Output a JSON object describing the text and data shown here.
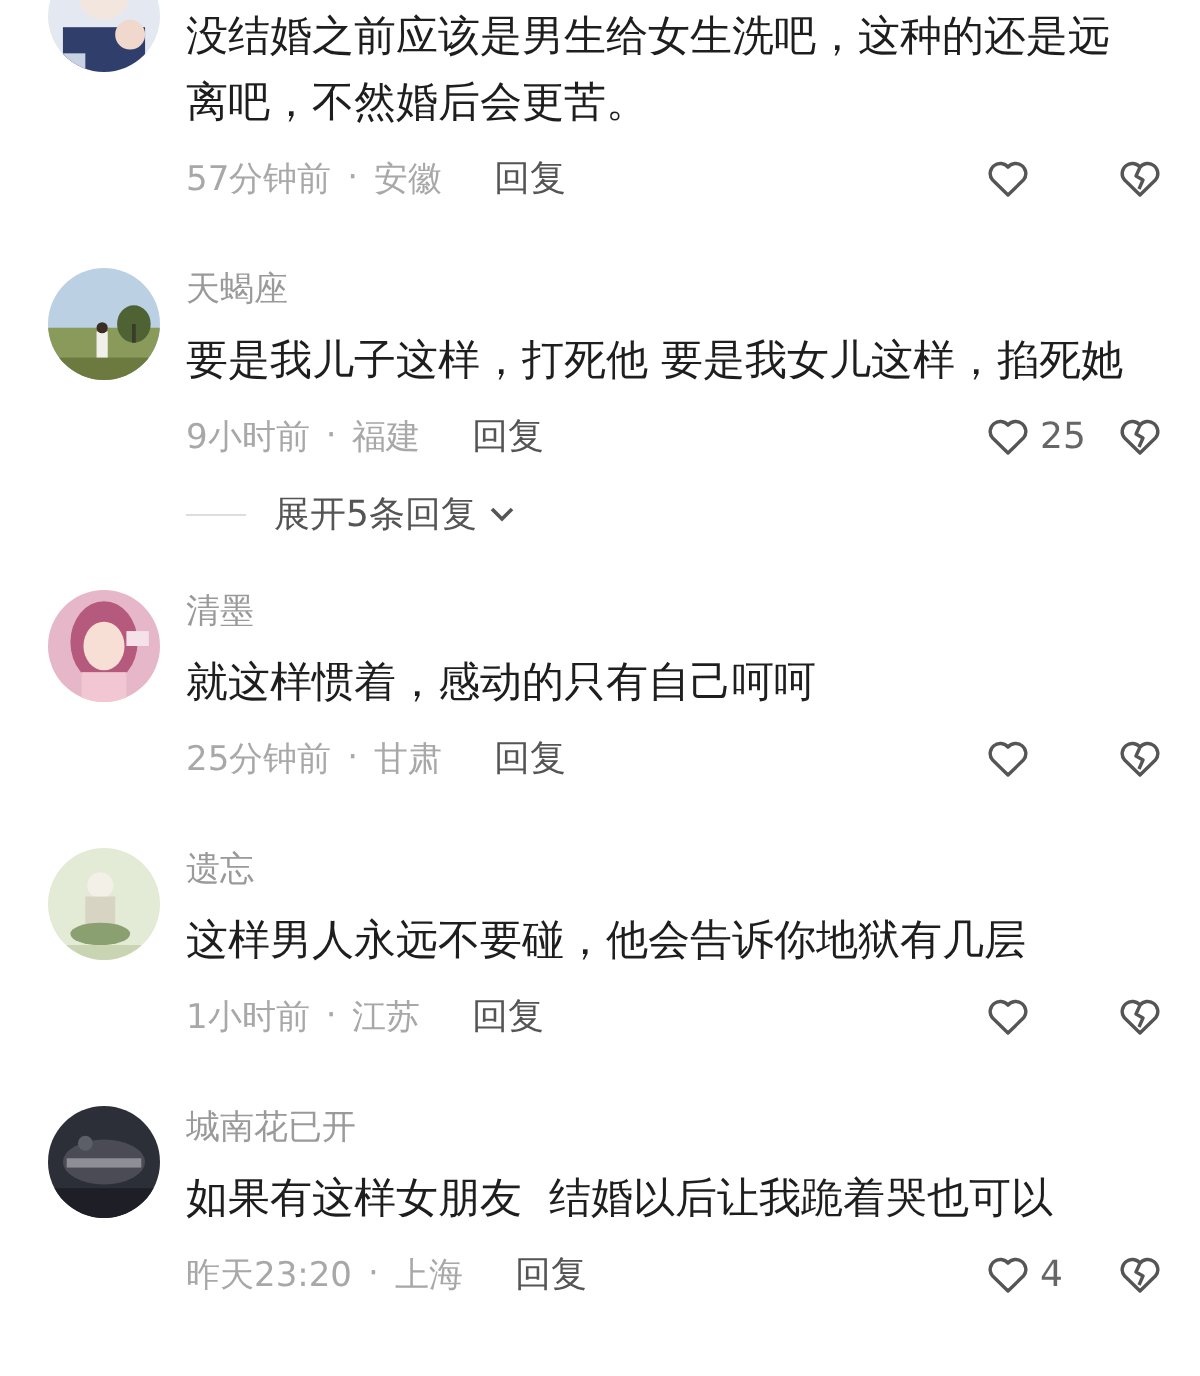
{
  "comments": [
    {
      "text": "没结婚之前应该是男生给女生洗吧，这种的还是远离吧，不然婚后会更苦。",
      "time": "57分钟前",
      "separator": "·",
      "location": "安徽",
      "reply": "回复"
    },
    {
      "author": "天蝎座",
      "text": "要是我儿子这样，打死他 要是我女儿这样，掐死她",
      "time": "9小时前",
      "separator": "·",
      "location": "福建",
      "reply": "回复",
      "likes": "25",
      "replies_toggle": "展开5条回复"
    },
    {
      "author": "清墨",
      "text": "就这样惯着，感动的只有自己呵呵",
      "time": "25分钟前",
      "separator": "·",
      "location": "甘肃",
      "reply": "回复"
    },
    {
      "author": "遗忘",
      "text": "这样男人永远不要碰，他会告诉你地狱有几层",
      "time": "1小时前",
      "separator": "·",
      "location": "江苏",
      "reply": "回复"
    },
    {
      "author": "城南花已开",
      "text": "如果有这样女朋友  结婚以后让我跪着哭也可以",
      "time": "昨天23:20",
      "separator": "·",
      "location": "上海",
      "reply": "回复",
      "likes": "4"
    }
  ]
}
